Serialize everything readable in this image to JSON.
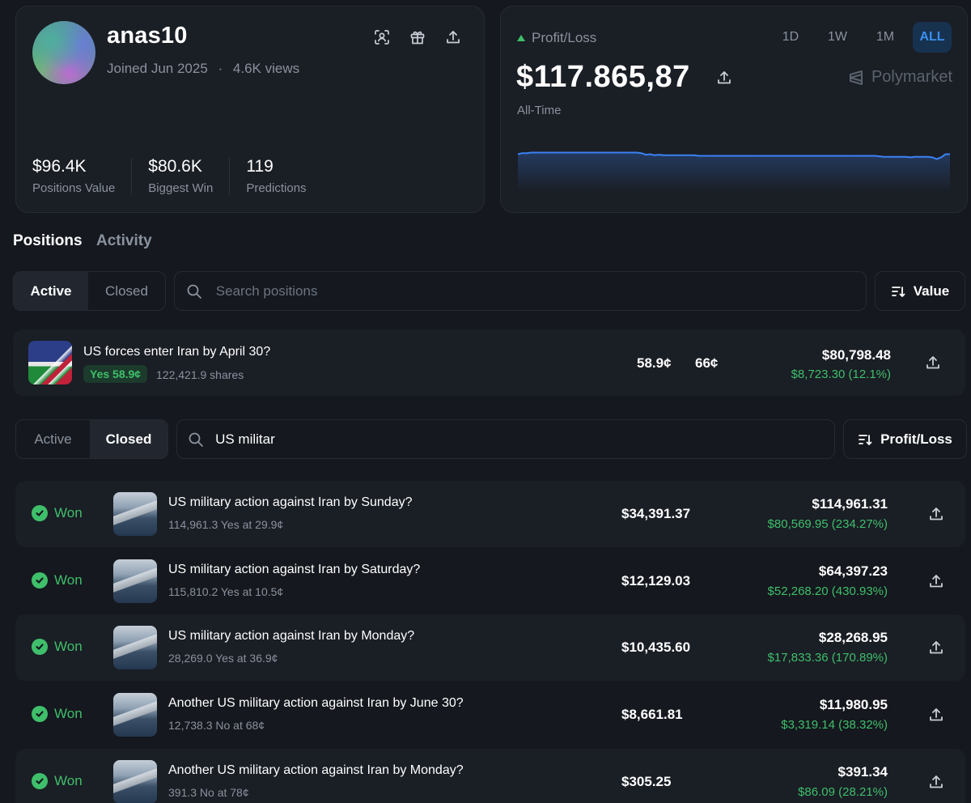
{
  "profile": {
    "username": "anas10",
    "joined": "Joined Jun 2025",
    "separator": "·",
    "views": "4.6K views",
    "stats": [
      {
        "value": "$96.4K",
        "label": "Positions Value"
      },
      {
        "value": "$80.6K",
        "label": "Biggest Win"
      },
      {
        "value": "119",
        "label": "Predictions"
      }
    ],
    "icons": [
      "scan-icon",
      "gift-icon",
      "share-icon"
    ]
  },
  "pnl": {
    "label": "Profit/Loss",
    "value": "$117.865,87",
    "period_label": "All-Time",
    "ranges": [
      "1D",
      "1W",
      "1M",
      "ALL"
    ],
    "active_range": "ALL",
    "brand": "Polymarket",
    "line_color": "#3b82f6",
    "series": [
      0.72,
      0.74,
      0.74,
      0.75,
      0.75,
      0.75,
      0.75,
      0.75,
      0.75,
      0.75,
      0.75,
      0.75,
      0.75,
      0.75,
      0.75,
      0.75,
      0.75,
      0.75,
      0.75,
      0.75,
      0.75,
      0.75,
      0.75,
      0.75,
      0.75,
      0.75,
      0.75,
      0.75,
      0.74,
      0.71,
      0.72,
      0.7,
      0.71,
      0.7,
      0.7,
      0.7,
      0.7,
      0.7,
      0.7,
      0.7,
      0.7,
      0.69,
      0.69,
      0.69,
      0.69,
      0.69,
      0.69,
      0.69,
      0.69,
      0.69,
      0.69,
      0.69,
      0.69,
      0.69,
      0.69,
      0.69,
      0.69,
      0.69,
      0.69,
      0.69,
      0.69,
      0.69,
      0.69,
      0.69,
      0.69,
      0.69,
      0.69,
      0.69,
      0.69,
      0.69,
      0.69,
      0.69,
      0.69,
      0.69,
      0.69,
      0.69,
      0.69,
      0.69,
      0.69,
      0.69,
      0.69,
      0.69,
      0.68,
      0.67,
      0.67,
      0.67,
      0.67,
      0.67,
      0.67,
      0.66,
      0.67,
      0.67,
      0.67,
      0.67,
      0.66,
      0.63,
      0.66,
      0.72,
      0.72
    ]
  },
  "tabs": [
    "Positions",
    "Activity"
  ],
  "active_filter": {
    "options": [
      "Active",
      "Closed"
    ],
    "selected": "Active",
    "search_placeholder": "Search positions",
    "sort_label": "Value"
  },
  "active_positions": [
    {
      "title": "US forces enter Iran by April 30?",
      "badge": "Yes 58.9¢",
      "shares": "122,421.9 shares",
      "avg": "58.9¢",
      "current": "66¢",
      "value": "$80,798.48",
      "pnl": "$8,723.30 (12.1%)"
    }
  ],
  "closed_filter": {
    "options": [
      "Active",
      "Closed"
    ],
    "selected": "Closed",
    "search_value": "US militar",
    "sort_label": "Profit/Loss"
  },
  "closed_positions": [
    {
      "status": "Won",
      "title": "US military action against Iran by Sunday?",
      "sub": "114,961.3 Yes at 29.9¢",
      "cost": "$34,391.37",
      "value": "$114,961.31",
      "pnl": "$80,569.95 (234.27%)"
    },
    {
      "status": "Won",
      "title": "US military action against Iran by Saturday?",
      "sub": "115,810.2 Yes at 10.5¢",
      "cost": "$12,129.03",
      "value": "$64,397.23",
      "pnl": "$52,268.20 (430.93%)"
    },
    {
      "status": "Won",
      "title": "US military action against Iran by Monday?",
      "sub": "28,269.0 Yes at 36.9¢",
      "cost": "$10,435.60",
      "value": "$28,268.95",
      "pnl": "$17,833.36 (170.89%)"
    },
    {
      "status": "Won",
      "title": "Another US military action against Iran by June 30?",
      "sub": "12,738.3 No at 68¢",
      "cost": "$8,661.81",
      "value": "$11,980.95",
      "pnl": "$3,319.14 (38.32%)"
    },
    {
      "status": "Won",
      "title": "Another US military action against Iran by Monday?",
      "sub": "391.3 No at 78¢",
      "cost": "$305.25",
      "value": "$391.34",
      "pnl": "$86.09 (28.21%)"
    }
  ]
}
